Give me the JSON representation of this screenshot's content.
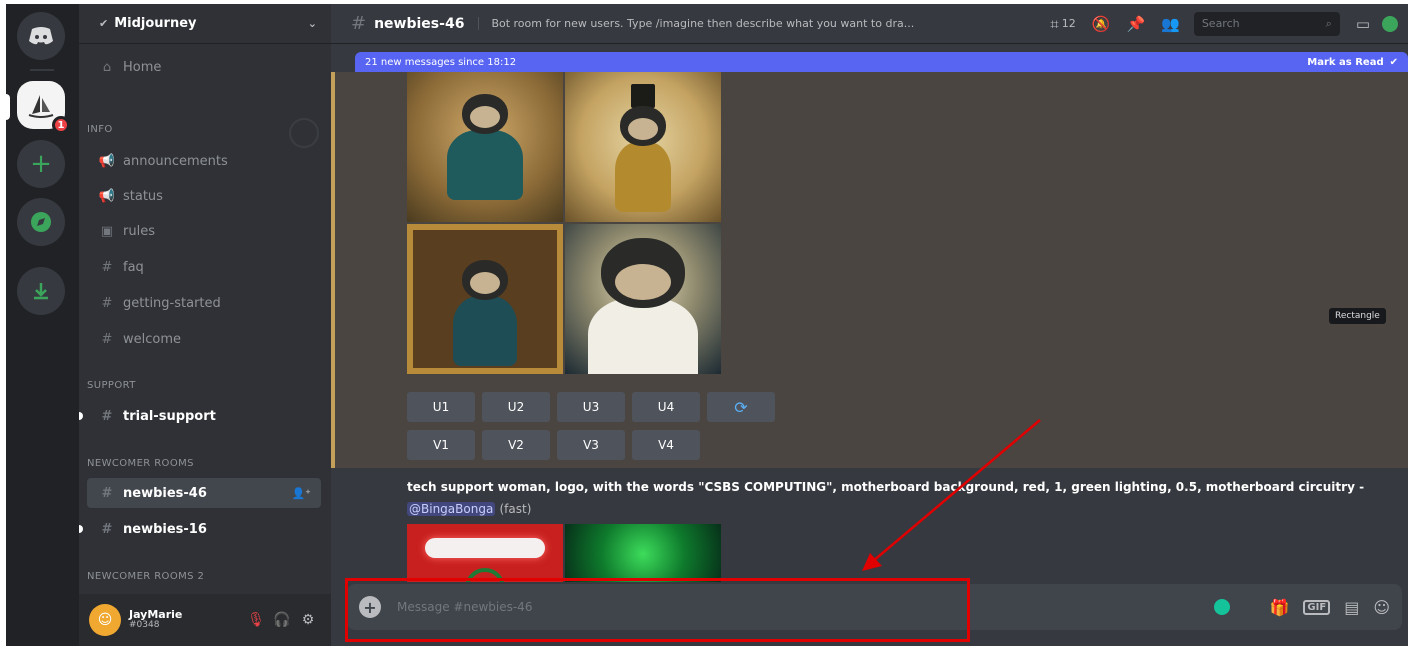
{
  "server": {
    "name": "Midjourney"
  },
  "sidebar": {
    "home": "Home",
    "categories": {
      "info": "INFO",
      "support": "SUPPORT",
      "newcomer": "NEWCOMER ROOMS",
      "newcomer2": "NEWCOMER ROOMS 2"
    },
    "channels": {
      "announcements": "announcements",
      "status": "status",
      "rules": "rules",
      "faq": "faq",
      "getting_started": "getting-started",
      "welcome": "welcome",
      "trial_support": "trial-support",
      "newbies_46": "newbies-46",
      "newbies_16": "newbies-16"
    }
  },
  "user": {
    "name": "JayMarie",
    "tag": "#0348"
  },
  "rail": {
    "badge": "1"
  },
  "topbar": {
    "channel": "newbies-46",
    "topic": "Bot room for new users. Type /imagine then describe what you want to dra...",
    "threads_count": "12",
    "search_placeholder": "Search"
  },
  "new_messages": {
    "text": "21 new messages since 18:12",
    "action": "Mark as Read"
  },
  "buttons": {
    "upscale": [
      "U1",
      "U2",
      "U3",
      "U4"
    ],
    "variation": [
      "V1",
      "V2",
      "V3",
      "V4"
    ],
    "reroll_icon": "refresh-icon"
  },
  "tooltip": "Rectangle",
  "message2": {
    "prompt": "tech support woman, logo, with the words \"CSBS COMPUTING\", motherboard background, red, 1, green lighting, 0.5, motherboard circuitry",
    "separator": " - ",
    "mention": "@BingaBonga",
    "speed": "(fast)"
  },
  "composer": {
    "placeholder": "Message #newbies-46"
  },
  "annotation": {
    "color": "#e00000"
  }
}
